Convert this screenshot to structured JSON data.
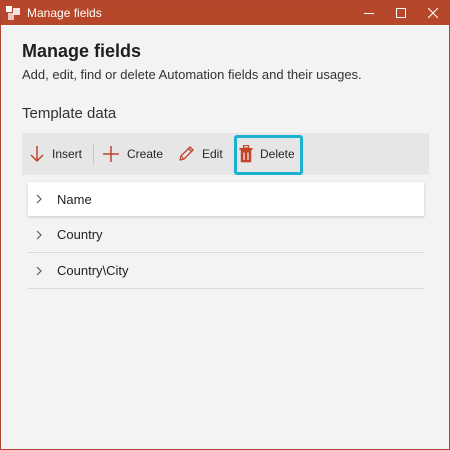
{
  "window": {
    "title": "Manage fields",
    "colors": {
      "titlebar": "#b7472a",
      "accent": "#c0452b",
      "highlight": "#1db1d1"
    }
  },
  "dialog": {
    "heading": "Manage fields",
    "description": "Add, edit, find or delete Automation fields and their usages.",
    "section_label": "Template data"
  },
  "toolbar": {
    "insert_label": "Insert",
    "create_label": "Create",
    "edit_label": "Edit",
    "delete_label": "Delete"
  },
  "tree": {
    "items": [
      {
        "label": "Name",
        "selected": true
      },
      {
        "label": "Country",
        "selected": false
      },
      {
        "label": "Country\\City",
        "selected": false
      }
    ]
  }
}
